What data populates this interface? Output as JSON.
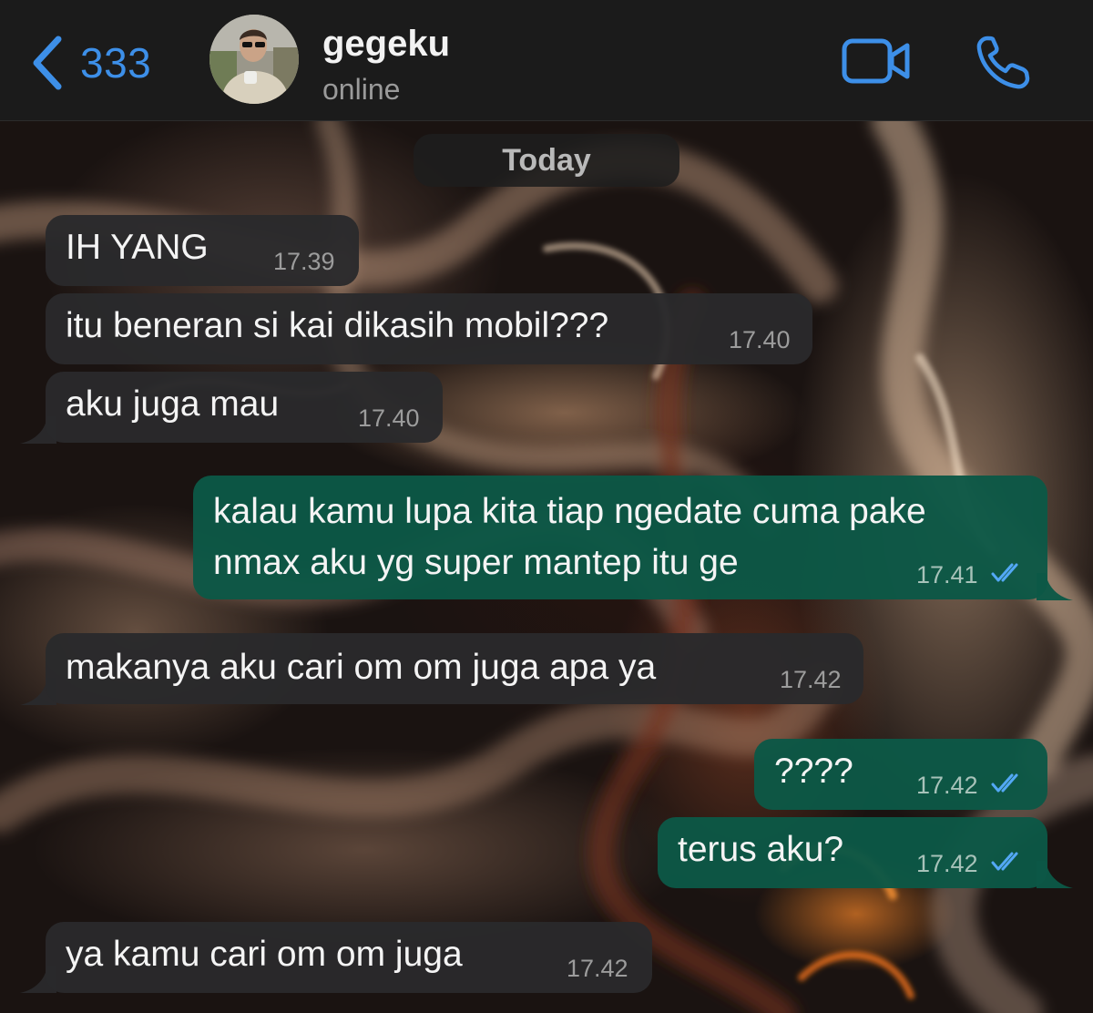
{
  "header": {
    "back_count": "333",
    "contact_name": "gegeku",
    "contact_status": "online",
    "icons": [
      "chevron-left-icon",
      "video-camera-icon",
      "phone-icon"
    ]
  },
  "date_separator": "Today",
  "messages": [
    {
      "direction": "incoming",
      "text": "IH YANG",
      "time": "17.39"
    },
    {
      "direction": "incoming",
      "text": "itu beneran si kai dikasih mobil???",
      "time": "17.40"
    },
    {
      "direction": "incoming",
      "text": "aku juga mau",
      "time": "17.40"
    },
    {
      "direction": "outgoing",
      "lines": [
        "kalau kamu lupa kita tiap ngedate cuma pake",
        "nmax aku yg super mantep itu ge"
      ],
      "time": "17.41",
      "status": "read"
    },
    {
      "direction": "incoming",
      "text": "makanya aku cari om om juga apa ya",
      "time": "17.42"
    },
    {
      "direction": "outgoing",
      "text": "????",
      "time": "17.42",
      "status": "read"
    },
    {
      "direction": "outgoing",
      "text": "terus aku?",
      "time": "17.42",
      "status": "read"
    },
    {
      "direction": "incoming",
      "text": "ya kamu cari om om juga",
      "time": "17.42"
    }
  ],
  "colors": {
    "accent": "#3d8fe8",
    "header_bg": "#1b1b1b",
    "incoming_bubble": "#2a2a2c",
    "outgoing_bubble": "#0c5846",
    "read_ticks": "#53a8f5"
  }
}
